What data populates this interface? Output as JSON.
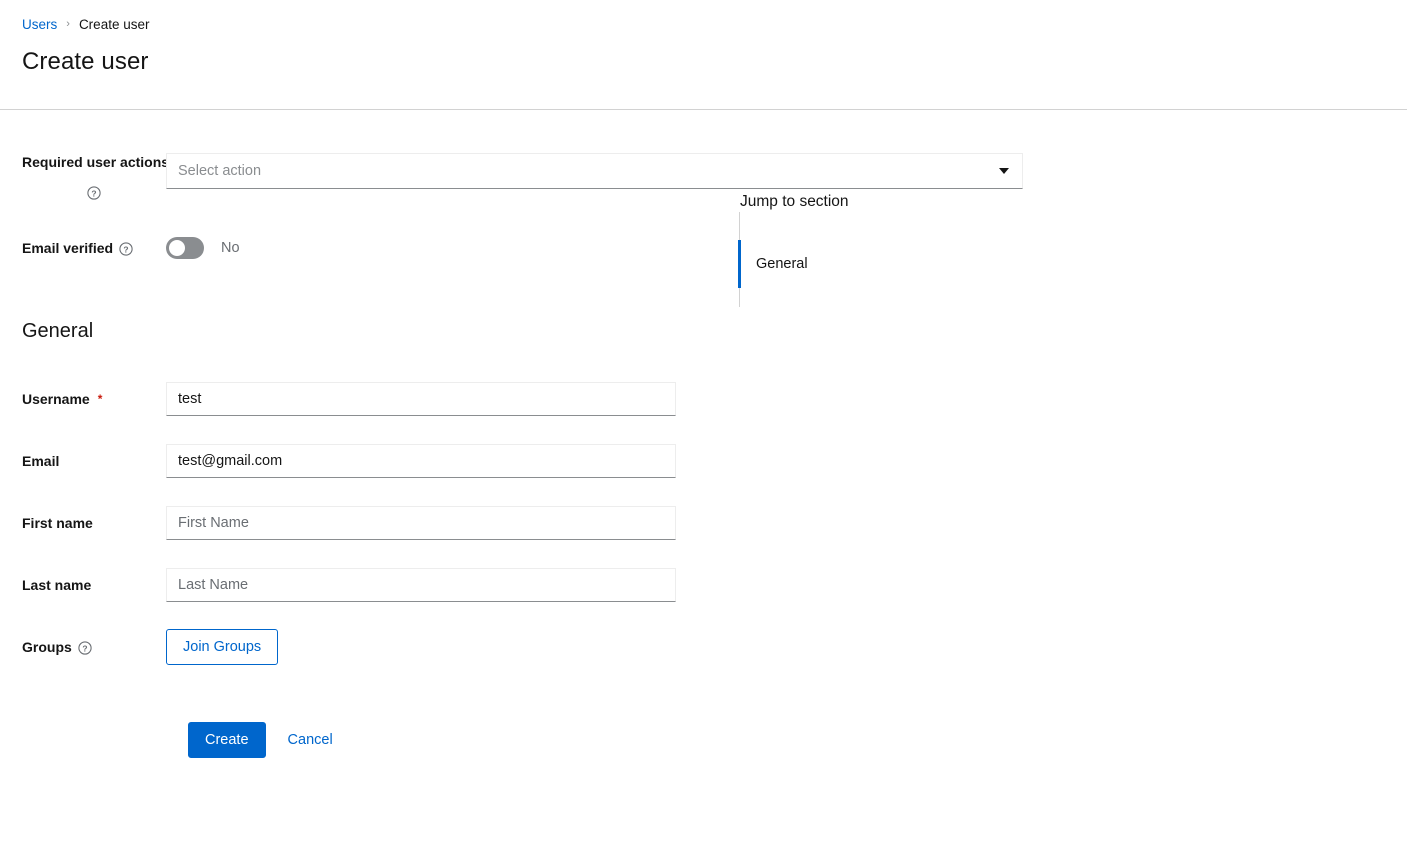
{
  "breadcrumb": {
    "parent": "Users",
    "separator": "›",
    "current": "Create user"
  },
  "page": {
    "title": "Create user"
  },
  "form": {
    "required_user_actions": {
      "label": "Required user actions",
      "help_icon": "help-circle-icon",
      "placeholder": "Select action",
      "value": "",
      "caret_icon": "caret-down-icon"
    },
    "email_verified": {
      "label": "Email verified",
      "help_icon": "help-circle-icon",
      "state_label": "No",
      "checked": false
    },
    "general_section": {
      "title": "General",
      "username": {
        "label": "Username",
        "required_marker": "*",
        "value": "test",
        "placeholder": ""
      },
      "email": {
        "label": "Email",
        "value": "test@gmail.com",
        "placeholder": ""
      },
      "first_name": {
        "label": "First name",
        "value": "",
        "placeholder": "First Name"
      },
      "last_name": {
        "label": "Last name",
        "value": "",
        "placeholder": "Last Name"
      },
      "groups": {
        "label": "Groups",
        "help_icon": "help-circle-icon",
        "join_button_label": "Join Groups"
      }
    },
    "actions": {
      "create_label": "Create",
      "cancel_label": "Cancel"
    }
  },
  "jump_to_section": {
    "title": "Jump to section",
    "items": [
      {
        "label": "General",
        "active": true
      }
    ]
  },
  "colors": {
    "accent": "#0066cc",
    "required": "#c9190b",
    "toggle_off": "#8a8d90",
    "border_light": "#ededed",
    "border_bottom": "#8a8d90",
    "divider": "#d2d2d2",
    "text": "#151515",
    "muted_text": "#6a6e73"
  }
}
